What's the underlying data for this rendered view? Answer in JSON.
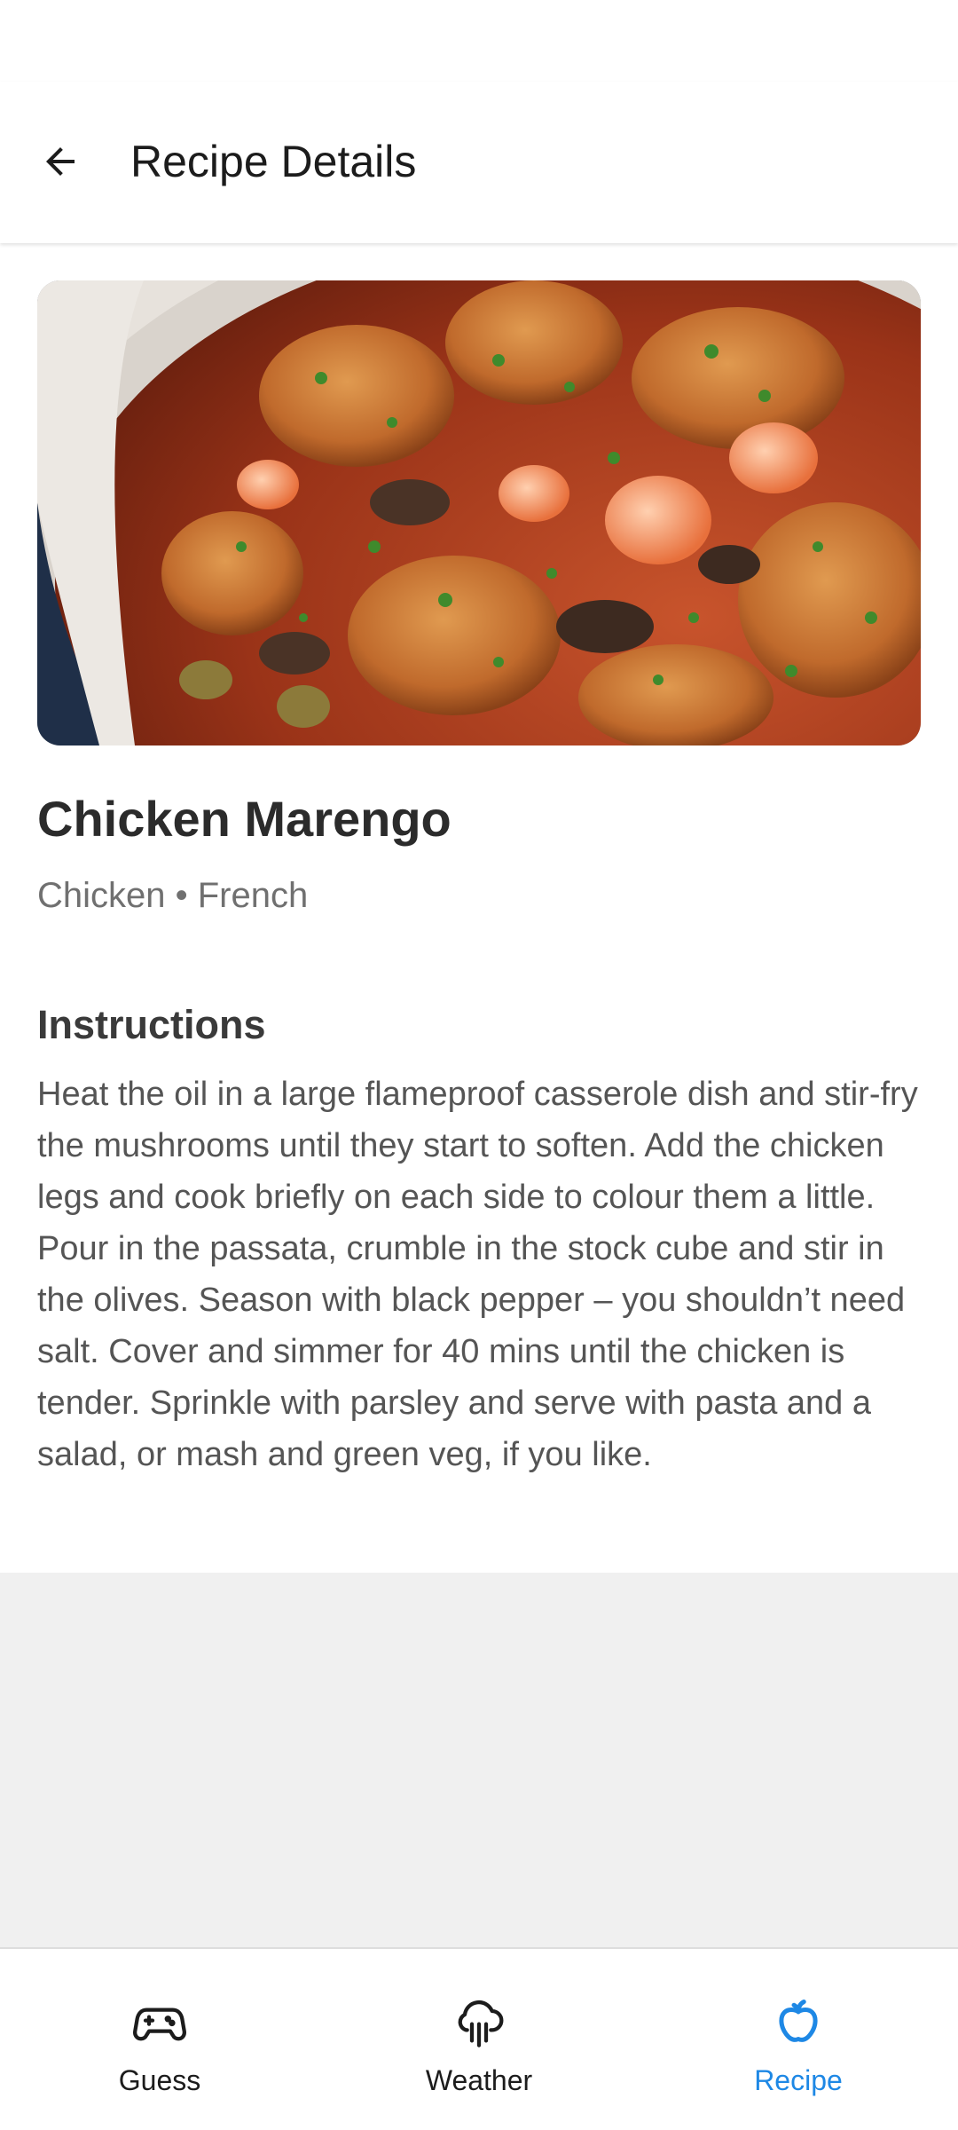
{
  "app_bar": {
    "title": "Recipe Details",
    "back_icon": "arrow-left-icon"
  },
  "recipe": {
    "name": "Chicken Marengo",
    "meta": "Chicken • French",
    "image_alt": "Chicken Marengo dish in a casserole pot",
    "instructions_heading": "Instructions",
    "instructions": [
      "Heat the oil in a large flameproof casserole dish and stir-fry the mushrooms until they start to soften. Add the chicken legs and cook briefly on each side to colour them a little.",
      "Pour in the passata, crumble in the stock cube and stir in the olives. Season with black pepper – you shouldn’t need salt. Cover and simmer for 40 mins until the chicken is tender. Sprinkle with parsley and serve with pasta and a salad, or mash and green veg, if you like."
    ]
  },
  "bottom_nav": {
    "items": [
      {
        "label": "Guess",
        "icon": "gamepad-icon",
        "active": false
      },
      {
        "label": "Weather",
        "icon": "cloud-rain-icon",
        "active": false
      },
      {
        "label": "Recipe",
        "icon": "apple-icon",
        "active": true
      }
    ]
  },
  "colors": {
    "accent": "#1e88e5",
    "text_primary": "#1c1c1c",
    "text_secondary": "#707070",
    "background": "#f0f0f0"
  }
}
